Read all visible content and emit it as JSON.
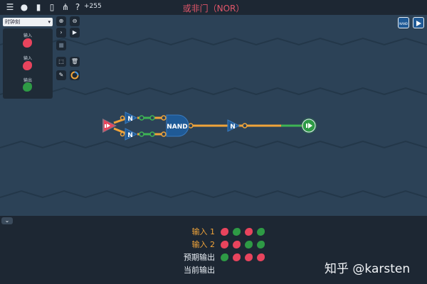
{
  "toolbar": {
    "icons": [
      "menu-icon",
      "chat-icon",
      "document-icon",
      "page-icon",
      "hierarchy-icon",
      "help-icon"
    ],
    "counter": "+255"
  },
  "title": "或非门（NOR）",
  "clock_select": {
    "value": "时钟刻"
  },
  "io_panel": {
    "items": [
      {
        "label": "输入",
        "color": "#e8445d"
      },
      {
        "label": "输入",
        "color": "#e8445d"
      },
      {
        "label": "输出",
        "color": "#2e9a45"
      }
    ]
  },
  "gates": {
    "not_a": "N",
    "not_b": "N",
    "nand": "NAND",
    "not_out": "N"
  },
  "chip_buttons": {
    "nand": "NAND"
  },
  "truth_table": {
    "rows": [
      {
        "label": "输入 1",
        "kind": "input",
        "values": [
          "red",
          "green",
          "red",
          "green"
        ]
      },
      {
        "label": "输入 2",
        "kind": "input",
        "values": [
          "red",
          "red",
          "green",
          "green"
        ]
      },
      {
        "label": "预期输出",
        "kind": "output",
        "values": [
          "green",
          "red",
          "red",
          "red"
        ]
      },
      {
        "label": "当前输出",
        "kind": "output",
        "values": []
      }
    ]
  },
  "colors": {
    "red": "#e8445d",
    "green": "#2e9a45",
    "wire": "#f0a43a",
    "gate": "#1f5a96"
  },
  "watermark": "知乎 @karsten"
}
